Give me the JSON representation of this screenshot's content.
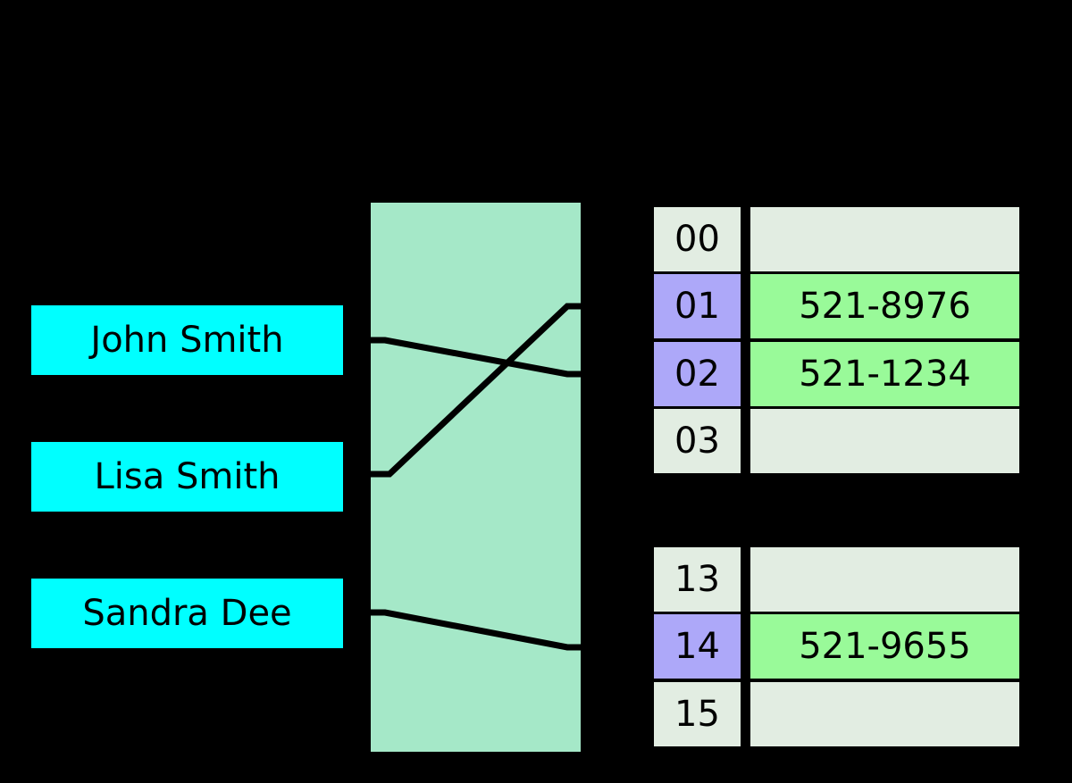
{
  "diagram": {
    "title": "hash-table-diagram",
    "background_color": "#000000",
    "keys": [
      {
        "label": "John Smith",
        "color": "#00ffff"
      },
      {
        "label": "Lisa Smith",
        "color": "#00ffff"
      },
      {
        "label": "Sandra Dee",
        "color": "#00ffff"
      }
    ],
    "hash_function": {
      "label": "",
      "color": "#a5e8c8"
    },
    "colors": {
      "key_box": "#00ffff",
      "hash_box": "#a5e8c8",
      "bucket_empty": "#e2ede2",
      "bucket_index_occupied": "#ada8f9",
      "bucket_value_occupied": "#99fa99",
      "line": "#000000"
    },
    "tables": [
      {
        "name": "upper",
        "rows": [
          {
            "index": "00",
            "value": "",
            "occupied": false
          },
          {
            "index": "01",
            "value": "521-8976",
            "occupied": true
          },
          {
            "index": "02",
            "value": "521-1234",
            "occupied": true
          },
          {
            "index": "03",
            "value": "",
            "occupied": false
          }
        ]
      },
      {
        "name": "lower",
        "rows": [
          {
            "index": "13",
            "value": "",
            "occupied": false
          },
          {
            "index": "14",
            "value": "521-9655",
            "occupied": true
          },
          {
            "index": "15",
            "value": "",
            "occupied": false
          }
        ]
      }
    ],
    "connections": [
      {
        "from": "John Smith",
        "to": "02"
      },
      {
        "from": "Lisa Smith",
        "to": "01"
      },
      {
        "from": "Sandra Dee",
        "to": "14"
      }
    ]
  }
}
